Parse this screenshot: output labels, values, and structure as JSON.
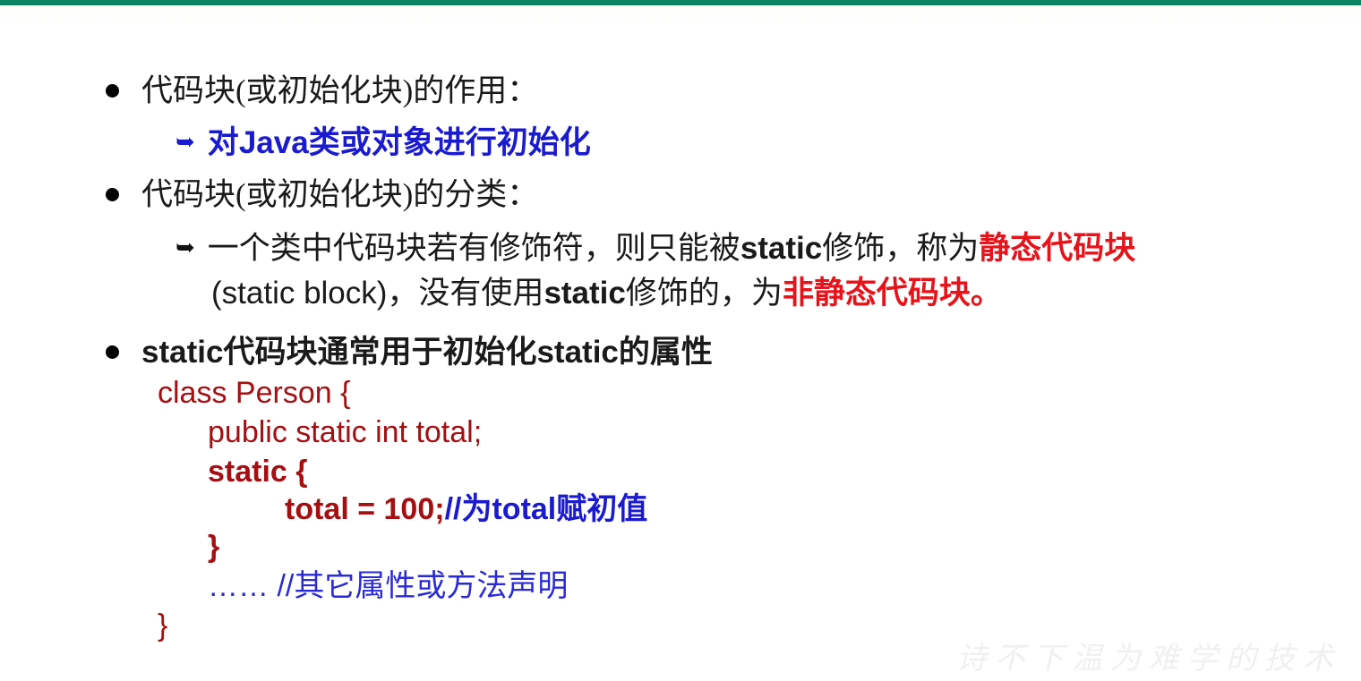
{
  "slide": {
    "top_bar_color": "#0a8465",
    "background_color": "#ffffff",
    "accent_blue": "#1a1ad0",
    "accent_red": "#e8131a",
    "code_red": "#a50f12",
    "watermark_text": "诗不下温为难学的技术"
  },
  "bullets": {
    "b1": {
      "marker": "filled-circle-bullet",
      "text": "代码块(或初始化块)的作用："
    },
    "b1_sub": {
      "marker": "arrow-bullet-blue",
      "prefix": "对",
      "keyword": "Java",
      "suffix": "类或对象进行初始化"
    },
    "b2": {
      "marker": "filled-circle-bullet",
      "text": "代码块(或初始化块)的分类："
    },
    "b2_sub_line1": {
      "marker": "arrow-bullet-black",
      "part1": "一个类中代码块若有修饰符，则只能被",
      "keyword": "static",
      "part2": "修饰，称为",
      "highlight": "静态代码块"
    },
    "b2_sub_line2": {
      "part1": "(static block)，没有使用",
      "keyword": "static",
      "part2": "修饰的，为",
      "highlight": "非静态代码块。"
    },
    "b3": {
      "marker": "filled-circle-bullet",
      "keyword1": "static",
      "part1": "代码块通常用于初始化",
      "keyword2": "static",
      "part2": "的属性"
    }
  },
  "code": {
    "lines": [
      {
        "id": "code-line-class",
        "indent": 0,
        "bold": false,
        "code": "class Person {",
        "comment": ""
      },
      {
        "id": "code-line-field",
        "indent": 1,
        "bold": false,
        "code": "public static int total;",
        "comment": ""
      },
      {
        "id": "code-line-static",
        "indent": 1,
        "bold": true,
        "code": "static {",
        "comment": ""
      },
      {
        "id": "code-line-assign",
        "indent": 2,
        "bold": true,
        "code": "total = 100;",
        "comment": "//为total赋初值"
      },
      {
        "id": "code-line-close-static",
        "indent": 1,
        "bold": true,
        "code": "}",
        "comment": ""
      },
      {
        "id": "code-line-ellipsis",
        "indent": 1,
        "bold": false,
        "code": "…… ",
        "comment": "//其它属性或方法声明"
      },
      {
        "id": "code-line-close-class",
        "indent": 0,
        "bold": false,
        "code": "}",
        "comment": ""
      }
    ],
    "comment_assign_keyword": "total",
    "comment_assign_prefix": "//为",
    "comment_assign_suffix": "赋初值"
  }
}
